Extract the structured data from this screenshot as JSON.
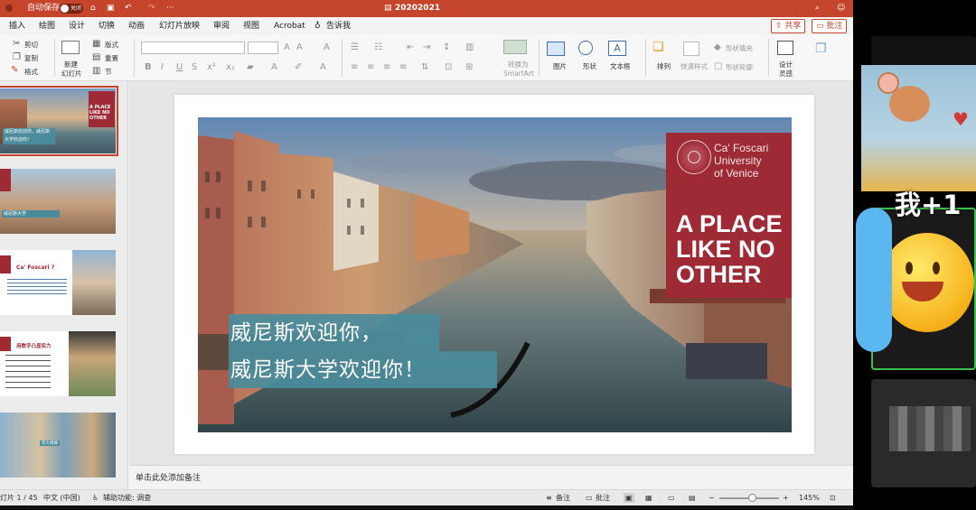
{
  "titlebar": {
    "autosave_label": "自动保存",
    "toggle_state": "关闭",
    "doc_title": "20202021",
    "more": "···"
  },
  "menu": [
    "插入",
    "绘图",
    "设计",
    "切换",
    "动画",
    "幻灯片放映",
    "审阅",
    "视图",
    "Acrobat",
    "告诉我"
  ],
  "share_label": "共享",
  "comment_label": "批注",
  "ribbon": {
    "cut": "剪切",
    "copy": "复制",
    "format": "格式",
    "new_slide_1": "新建",
    "new_slide_2": "幻灯片",
    "layout": "版式",
    "reset": "重置",
    "section": "节",
    "convert_1": "转换为",
    "convert_2": "SmartArt",
    "picture": "图片",
    "shapes": "形状",
    "textbox": "文本框",
    "arrange": "排列",
    "quick_styles": "快速样式",
    "shape_fill": "形状填充",
    "shape_outline": "形状轮廓",
    "designer_1": "设计",
    "designer_2": "灵感"
  },
  "thumbnails": [
    {
      "title": "A PLACE LIKE NO OTHER",
      "text": "威尼斯欢迎你，威尼斯大学欢迎你！"
    },
    {
      "title": "",
      "text": "威尼斯大学"
    },
    {
      "title": "Ca' Foscari ?",
      "text": ""
    },
    {
      "title": "用数字凸显实力",
      "text": ""
    },
    {
      "title": "",
      "text": "校大楼群"
    }
  ],
  "slide": {
    "logo_line1": "Ca' Foscari",
    "logo_line2": "University",
    "logo_line3": "of Venice",
    "headline_1": "A PLACE",
    "headline_2": "LIKE NO",
    "headline_3": "OTHER",
    "welcome_1": "威尼斯欢迎你，",
    "welcome_2": "威尼斯大学欢迎你！"
  },
  "notes_placeholder": "单击此处添加备注",
  "status": {
    "slide_count": "灯片 1 / 45",
    "language": "中文 (中国)",
    "accessibility": "辅助功能: 调查",
    "notes": "备注",
    "comments": "批注",
    "zoom": "145%"
  },
  "video": {
    "sticker_text": "我+1"
  },
  "colors": {
    "accent": "#c4452c",
    "slide_red": "#9e2a36",
    "teal": "#4a8c9c"
  }
}
